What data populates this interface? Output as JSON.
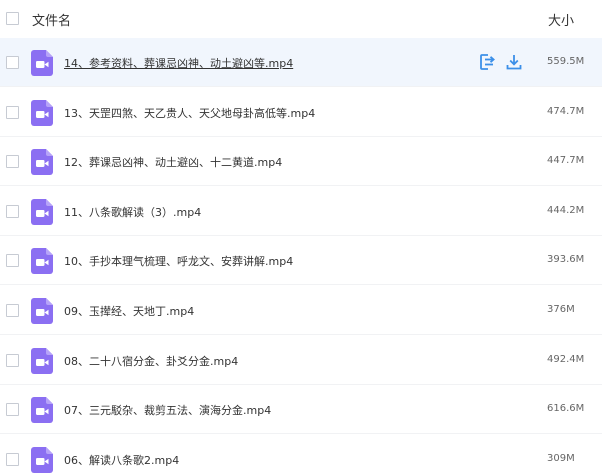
{
  "header": {
    "name_label": "文件名",
    "size_label": "大小"
  },
  "colors": {
    "accent": "#8b6ff2",
    "action_blue": "#3b8fe8",
    "row_highlight": "#f1f6fd"
  },
  "icons": {
    "file_type": "video-file-icon",
    "open": "open-icon",
    "download": "download-icon"
  },
  "files": [
    {
      "name": "14、参考资料、葬课忌凶神、动土避凶等.mp4",
      "size": "559.5M",
      "active": true
    },
    {
      "name": "13、天罡四煞、天乙贵人、天父地母卦高低等.mp4",
      "size": "474.7M",
      "active": false
    },
    {
      "name": "12、葬课忌凶神、动土避凶、十二黄道.mp4",
      "size": "447.7M",
      "active": false
    },
    {
      "name": "11、八条歌解读（3）.mp4",
      "size": "444.2M",
      "active": false
    },
    {
      "name": "10、手抄本理气梳理、呼龙文、安葬讲解.mp4",
      "size": "393.6M",
      "active": false
    },
    {
      "name": "09、玉撵经、天地丁.mp4",
      "size": "376M",
      "active": false
    },
    {
      "name": "08、二十八宿分金、卦爻分金.mp4",
      "size": "492.4M",
      "active": false
    },
    {
      "name": "07、三元駁杂、裁剪五法、演海分金.mp4",
      "size": "616.6M",
      "active": false
    },
    {
      "name": "06、解读八条歌2.mp4",
      "size": "309M",
      "active": false
    }
  ]
}
